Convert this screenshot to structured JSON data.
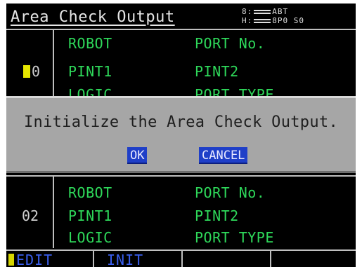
{
  "window": {
    "title": "Area Check Output",
    "status_line1": "8:",
    "status_line1_value": "ABT",
    "status_line2": "H:",
    "status_line2_value": "8P0 S0"
  },
  "areas": [
    {
      "number": "0",
      "fields": {
        "robot": "ROBOT",
        "port_no": "PORT No.",
        "pint1": "PINT1",
        "pint2": "PINT2",
        "logic": "LOGIC",
        "port_type": "PORT TYPE"
      }
    },
    {
      "number": "02",
      "fields": {
        "robot": "ROBOT",
        "port_no": "PORT No.",
        "pint1": "PINT1",
        "pint2": "PINT2",
        "logic": "LOGIC",
        "port_type": "PORT TYPE"
      }
    }
  ],
  "dialog": {
    "message": "Initialize the Area Check Output.",
    "ok_label": "OK",
    "cancel_label": "CANCEL"
  },
  "function_keys": [
    {
      "label": "EDIT"
    },
    {
      "label": "INIT"
    },
    {
      "label": ""
    },
    {
      "label": ""
    }
  ],
  "colors": {
    "background": "#000000",
    "field_text": "#2ed85a",
    "dialog_bg": "#a6a6a6",
    "button_bg": "#1f3fc8",
    "function_key_text": "#3a5ff0",
    "cursor": "#e6e600"
  }
}
